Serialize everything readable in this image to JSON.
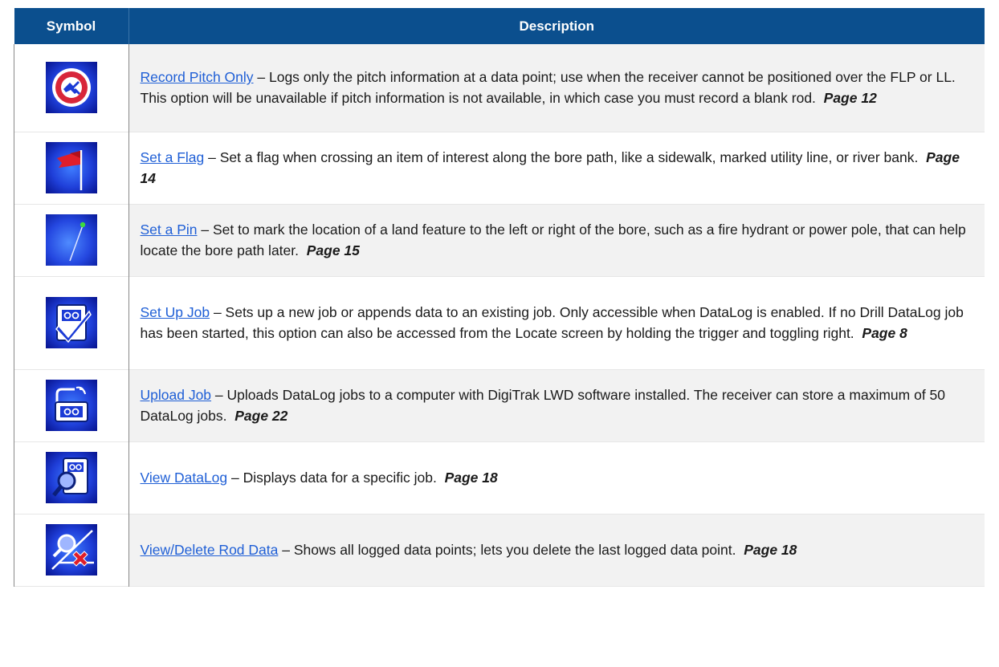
{
  "header": {
    "symbol": "Symbol",
    "description": "Description"
  },
  "rows": [
    {
      "icon": "record-pitch-icon",
      "link": "Record Pitch Only",
      "text": " – Logs only the pitch information at a data point; use when the receiver cannot be positioned over the FLP or LL. This option will be unavailable if pitch information is not available, in which case you must record a blank rod.",
      "page": "Page 12"
    },
    {
      "icon": "flag-icon",
      "link": "Set a Flag",
      "text": " – Set a flag when crossing an item of interest along the bore path, like a sidewalk, marked utility line, or river bank.",
      "page": "Page 14"
    },
    {
      "icon": "pin-icon",
      "link": "Set a Pin",
      "text": " – Set to mark the location of a land feature to the left or right of the bore, such as a fire hydrant or power pole, that can help locate the bore path later.",
      "page": "Page 15"
    },
    {
      "icon": "setup-job-icon",
      "link": "Set Up Job",
      "text": " – Sets up a new job or appends data to an existing job. Only accessible when DataLog is enabled. If no Drill DataLog job has been started, this option can also be accessed from the Locate screen by holding the trigger and toggling right.",
      "page": "Page 8"
    },
    {
      "icon": "upload-job-icon",
      "link": "Upload Job",
      "text": " – Uploads DataLog jobs to a computer with DigiTrak LWD software installed. The receiver can store a maximum of 50 DataLog jobs.",
      "page": "Page 22"
    },
    {
      "icon": "view-datalog-icon",
      "link": "View DataLog",
      "text": " – Displays data for a specific job.",
      "page": "Page 18"
    },
    {
      "icon": "view-delete-rod-icon",
      "link": "View/Delete Rod Data",
      "text": " – Shows all logged data points; lets you delete the last logged data point.",
      "page": "Page 18"
    }
  ]
}
